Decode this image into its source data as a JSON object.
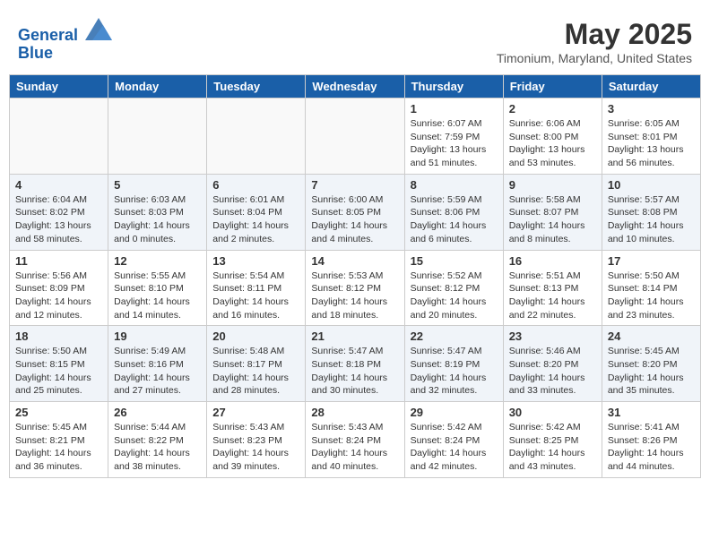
{
  "header": {
    "logo_line1": "General",
    "logo_line2": "Blue",
    "title": "May 2025",
    "location": "Timonium, Maryland, United States"
  },
  "days_of_week": [
    "Sunday",
    "Monday",
    "Tuesday",
    "Wednesday",
    "Thursday",
    "Friday",
    "Saturday"
  ],
  "weeks": [
    [
      {
        "day": "",
        "sunrise": "",
        "sunset": "",
        "daylight": ""
      },
      {
        "day": "",
        "sunrise": "",
        "sunset": "",
        "daylight": ""
      },
      {
        "day": "",
        "sunrise": "",
        "sunset": "",
        "daylight": ""
      },
      {
        "day": "",
        "sunrise": "",
        "sunset": "",
        "daylight": ""
      },
      {
        "day": "1",
        "sunrise": "Sunrise: 6:07 AM",
        "sunset": "Sunset: 7:59 PM",
        "daylight": "Daylight: 13 hours and 51 minutes."
      },
      {
        "day": "2",
        "sunrise": "Sunrise: 6:06 AM",
        "sunset": "Sunset: 8:00 PM",
        "daylight": "Daylight: 13 hours and 53 minutes."
      },
      {
        "day": "3",
        "sunrise": "Sunrise: 6:05 AM",
        "sunset": "Sunset: 8:01 PM",
        "daylight": "Daylight: 13 hours and 56 minutes."
      }
    ],
    [
      {
        "day": "4",
        "sunrise": "Sunrise: 6:04 AM",
        "sunset": "Sunset: 8:02 PM",
        "daylight": "Daylight: 13 hours and 58 minutes."
      },
      {
        "day": "5",
        "sunrise": "Sunrise: 6:03 AM",
        "sunset": "Sunset: 8:03 PM",
        "daylight": "Daylight: 14 hours and 0 minutes."
      },
      {
        "day": "6",
        "sunrise": "Sunrise: 6:01 AM",
        "sunset": "Sunset: 8:04 PM",
        "daylight": "Daylight: 14 hours and 2 minutes."
      },
      {
        "day": "7",
        "sunrise": "Sunrise: 6:00 AM",
        "sunset": "Sunset: 8:05 PM",
        "daylight": "Daylight: 14 hours and 4 minutes."
      },
      {
        "day": "8",
        "sunrise": "Sunrise: 5:59 AM",
        "sunset": "Sunset: 8:06 PM",
        "daylight": "Daylight: 14 hours and 6 minutes."
      },
      {
        "day": "9",
        "sunrise": "Sunrise: 5:58 AM",
        "sunset": "Sunset: 8:07 PM",
        "daylight": "Daylight: 14 hours and 8 minutes."
      },
      {
        "day": "10",
        "sunrise": "Sunrise: 5:57 AM",
        "sunset": "Sunset: 8:08 PM",
        "daylight": "Daylight: 14 hours and 10 minutes."
      }
    ],
    [
      {
        "day": "11",
        "sunrise": "Sunrise: 5:56 AM",
        "sunset": "Sunset: 8:09 PM",
        "daylight": "Daylight: 14 hours and 12 minutes."
      },
      {
        "day": "12",
        "sunrise": "Sunrise: 5:55 AM",
        "sunset": "Sunset: 8:10 PM",
        "daylight": "Daylight: 14 hours and 14 minutes."
      },
      {
        "day": "13",
        "sunrise": "Sunrise: 5:54 AM",
        "sunset": "Sunset: 8:11 PM",
        "daylight": "Daylight: 14 hours and 16 minutes."
      },
      {
        "day": "14",
        "sunrise": "Sunrise: 5:53 AM",
        "sunset": "Sunset: 8:12 PM",
        "daylight": "Daylight: 14 hours and 18 minutes."
      },
      {
        "day": "15",
        "sunrise": "Sunrise: 5:52 AM",
        "sunset": "Sunset: 8:12 PM",
        "daylight": "Daylight: 14 hours and 20 minutes."
      },
      {
        "day": "16",
        "sunrise": "Sunrise: 5:51 AM",
        "sunset": "Sunset: 8:13 PM",
        "daylight": "Daylight: 14 hours and 22 minutes."
      },
      {
        "day": "17",
        "sunrise": "Sunrise: 5:50 AM",
        "sunset": "Sunset: 8:14 PM",
        "daylight": "Daylight: 14 hours and 23 minutes."
      }
    ],
    [
      {
        "day": "18",
        "sunrise": "Sunrise: 5:50 AM",
        "sunset": "Sunset: 8:15 PM",
        "daylight": "Daylight: 14 hours and 25 minutes."
      },
      {
        "day": "19",
        "sunrise": "Sunrise: 5:49 AM",
        "sunset": "Sunset: 8:16 PM",
        "daylight": "Daylight: 14 hours and 27 minutes."
      },
      {
        "day": "20",
        "sunrise": "Sunrise: 5:48 AM",
        "sunset": "Sunset: 8:17 PM",
        "daylight": "Daylight: 14 hours and 28 minutes."
      },
      {
        "day": "21",
        "sunrise": "Sunrise: 5:47 AM",
        "sunset": "Sunset: 8:18 PM",
        "daylight": "Daylight: 14 hours and 30 minutes."
      },
      {
        "day": "22",
        "sunrise": "Sunrise: 5:47 AM",
        "sunset": "Sunset: 8:19 PM",
        "daylight": "Daylight: 14 hours and 32 minutes."
      },
      {
        "day": "23",
        "sunrise": "Sunrise: 5:46 AM",
        "sunset": "Sunset: 8:20 PM",
        "daylight": "Daylight: 14 hours and 33 minutes."
      },
      {
        "day": "24",
        "sunrise": "Sunrise: 5:45 AM",
        "sunset": "Sunset: 8:20 PM",
        "daylight": "Daylight: 14 hours and 35 minutes."
      }
    ],
    [
      {
        "day": "25",
        "sunrise": "Sunrise: 5:45 AM",
        "sunset": "Sunset: 8:21 PM",
        "daylight": "Daylight: 14 hours and 36 minutes."
      },
      {
        "day": "26",
        "sunrise": "Sunrise: 5:44 AM",
        "sunset": "Sunset: 8:22 PM",
        "daylight": "Daylight: 14 hours and 38 minutes."
      },
      {
        "day": "27",
        "sunrise": "Sunrise: 5:43 AM",
        "sunset": "Sunset: 8:23 PM",
        "daylight": "Daylight: 14 hours and 39 minutes."
      },
      {
        "day": "28",
        "sunrise": "Sunrise: 5:43 AM",
        "sunset": "Sunset: 8:24 PM",
        "daylight": "Daylight: 14 hours and 40 minutes."
      },
      {
        "day": "29",
        "sunrise": "Sunrise: 5:42 AM",
        "sunset": "Sunset: 8:24 PM",
        "daylight": "Daylight: 14 hours and 42 minutes."
      },
      {
        "day": "30",
        "sunrise": "Sunrise: 5:42 AM",
        "sunset": "Sunset: 8:25 PM",
        "daylight": "Daylight: 14 hours and 43 minutes."
      },
      {
        "day": "31",
        "sunrise": "Sunrise: 5:41 AM",
        "sunset": "Sunset: 8:26 PM",
        "daylight": "Daylight: 14 hours and 44 minutes."
      }
    ]
  ]
}
